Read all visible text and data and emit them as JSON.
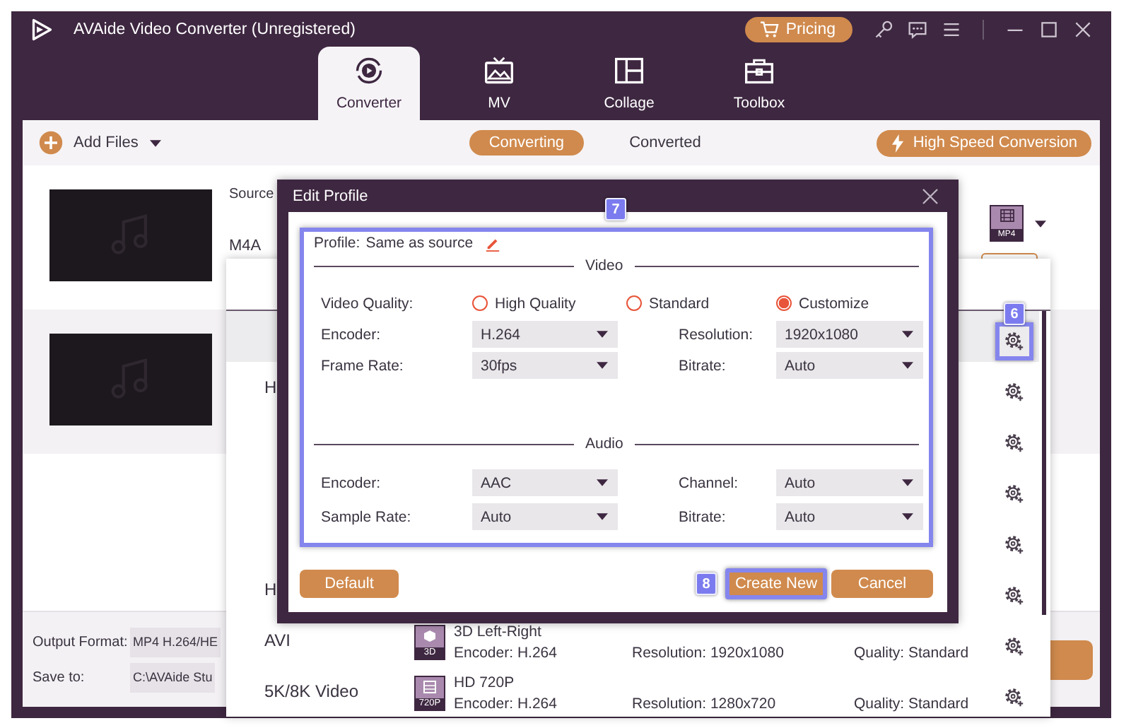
{
  "window": {
    "title": "AVAide Video Converter (Unregistered)",
    "pricing": "Pricing"
  },
  "nav_tabs": [
    {
      "kind": "converter",
      "label": "Converter",
      "selected": true
    },
    {
      "kind": "mv",
      "label": "MV",
      "selected": false
    },
    {
      "kind": "collage",
      "label": "Collage",
      "selected": false
    },
    {
      "kind": "toolbox",
      "label": "Toolbox",
      "selected": false
    }
  ],
  "toolbar": {
    "add_files": "Add Files",
    "views": [
      {
        "label": "Converting",
        "selected": true
      },
      {
        "label": "Converted",
        "selected": false
      }
    ],
    "high_speed": "High Speed Conversion"
  },
  "files": [
    {
      "source": "Source",
      "format": "M4A",
      "target": "MP4",
      "selected": false
    },
    {
      "selected": true
    }
  ],
  "bottom": {
    "output_format_label": "Output Format:",
    "output_format": "MP4 H.264/HE",
    "save_to_label": "Save to:",
    "save_to": "C:\\AVAide Stu"
  },
  "format_panel": {
    "callout": "6",
    "categories": [
      {
        "label": "H"
      },
      {
        "label": "H"
      },
      {
        "label": "AVI"
      },
      {
        "label": "5K/8K Video"
      }
    ],
    "presets": [
      {
        "badge": "3D",
        "name": "3D Left-Right",
        "encoder": "Encoder: H.264",
        "resolution": "Resolution: 1920x1080",
        "quality": "Quality: Standard"
      },
      {
        "badge": "720P",
        "name": "HD 720P",
        "encoder": "Encoder: H.264",
        "resolution": "Resolution: 1280x720",
        "quality": "Quality: Standard"
      }
    ]
  },
  "edit_profile": {
    "title": "Edit Profile",
    "callout": "7",
    "profile_label": "Profile:",
    "profile_value": "Same as source",
    "video_heading": "Video",
    "video_quality_label": "Video Quality:",
    "quality_options": [
      {
        "label": "High Quality",
        "selected": false
      },
      {
        "label": "Standard",
        "selected": false
      },
      {
        "label": "Customize",
        "selected": true
      }
    ],
    "video_fields": [
      {
        "label": "Encoder:",
        "value": "H.264"
      },
      {
        "label": "Resolution:",
        "value": "1920x1080"
      },
      {
        "label": "Frame Rate:",
        "value": "30fps"
      },
      {
        "label": "Bitrate:",
        "value": "Auto"
      }
    ],
    "audio_heading": "Audio",
    "audio_fields": [
      {
        "label": "Encoder:",
        "value": "AAC"
      },
      {
        "label": "Channel:",
        "value": "Auto"
      },
      {
        "label": "Sample Rate:",
        "value": "Auto"
      },
      {
        "label": "Bitrate:",
        "value": "Auto"
      }
    ],
    "buttons": [
      {
        "label": "Default",
        "highlighted": false
      },
      {
        "label": "Create New",
        "highlighted": true,
        "callout": "8"
      },
      {
        "label": "Cancel",
        "highlighted": false
      }
    ]
  }
}
